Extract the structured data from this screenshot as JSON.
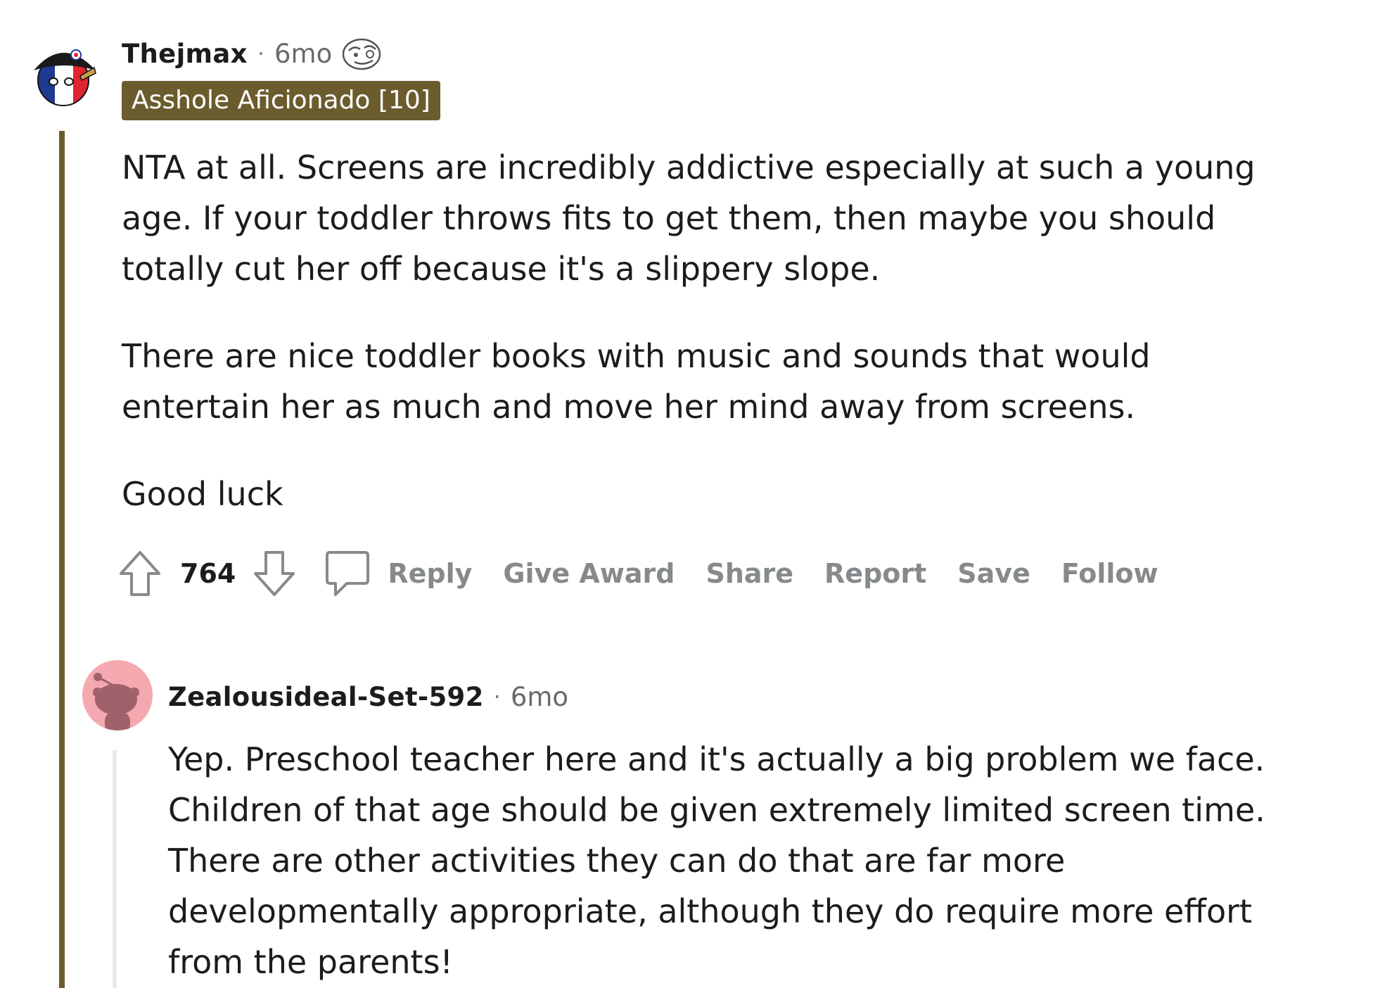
{
  "comment": {
    "username": "Thejmax",
    "separator": "·",
    "time": "6mo",
    "flair": "Asshole Aficionado [10]",
    "paragraphs": [
      "NTA at all. Screens are incredibly addictive especially at such a young age. If your toddler throws fits to get them, then maybe you should totally cut her off because it's a slippery slope.",
      "There are nice toddler books with music and sounds that would entertain her as much and move her mind away from screens.",
      "Good luck"
    ],
    "score": "764",
    "actions": {
      "reply": "Reply",
      "give_award": "Give Award",
      "share": "Share",
      "report": "Report",
      "save": "Save",
      "follow": "Follow"
    }
  },
  "reply": {
    "username": "Zealousideal-Set-592",
    "separator": "·",
    "time": "6mo",
    "paragraphs": [
      "Yep. Preschool teacher here and it's actually a big problem we face. Children of that age should be given extremely limited screen time. There are other activities they can do that are far more developmentally appropriate, although they do require more effort from the parents!"
    ]
  },
  "colors": {
    "flair_bg": "#6b5c2e",
    "thread_line": "#6b5c2e",
    "reply_thread_line": "#e9e9e9",
    "action_text": "#878a8c",
    "reply_avatar_bg": "#f4a9b0"
  },
  "icons": {
    "upvote": "upvote-arrow-icon",
    "downvote": "downvote-arrow-icon",
    "comment": "speech-bubble-icon",
    "award": "award-emoji-icon"
  }
}
